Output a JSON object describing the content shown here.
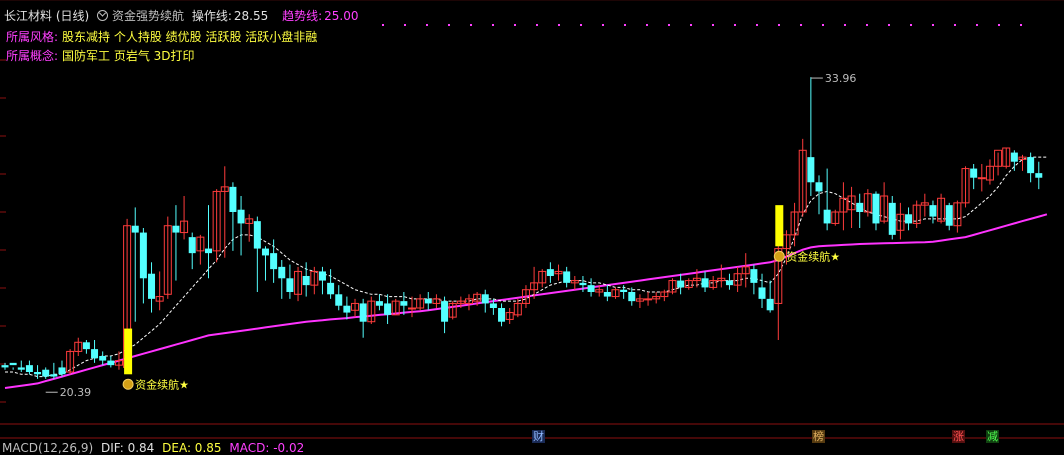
{
  "header": {
    "title": "长江材料 (日线)",
    "indicator": "资金强势续航",
    "op_label": "操作线:",
    "op_value": "28.55",
    "trend_label": "趋势线:",
    "trend_value": "25.00"
  },
  "info": {
    "style_label": "所属风格:",
    "style_value": "股东减持 个人持股 绩优股 活跃股 活跃小盘非融",
    "concept_label": "所属概念:",
    "concept_value": "国防军工 页岩气 3D打印"
  },
  "annotations": {
    "high_label": "33.96",
    "low_label": "20.39",
    "signal_label": "资金续航★"
  },
  "badges": {
    "cai": "财",
    "bang": "榜",
    "zhang": "涨",
    "jian": "减"
  },
  "footer": {
    "macd_label": "MACD(12,26,9)",
    "dif_label": "DIF: 0.84",
    "dea_label": "DEA: 0.85",
    "macd_value_label": "MACD: -0.02"
  },
  "colors": {
    "up": "#ff3c3c",
    "down": "#54ffff",
    "trend_line": "#ff33ff",
    "op_line": "#ffffff",
    "signal_bar": "#ffff00",
    "grid": "#8b1010"
  },
  "chart_data": {
    "type": "candlestick",
    "price_range": [
      19.0,
      36.5
    ],
    "candles": [
      [
        21.4,
        21.5,
        21.3,
        21.2
      ],
      [
        21.5,
        21.3,
        21.4,
        21.2
      ],
      [
        21.3,
        21.6,
        21.2,
        21.1
      ],
      [
        21.4,
        21.6,
        21.1,
        21.0
      ],
      [
        21.1,
        21.4,
        21.0,
        20.8
      ],
      [
        21.2,
        21.3,
        20.9,
        20.8
      ],
      [
        21.0,
        21.5,
        20.9,
        20.8
      ],
      [
        21.3,
        21.6,
        21.0,
        20.9
      ],
      [
        21.1,
        22.1,
        22.0,
        21.0
      ],
      [
        22.0,
        22.6,
        22.4,
        21.8
      ],
      [
        22.4,
        22.5,
        22.1,
        21.9
      ],
      [
        22.1,
        22.5,
        21.7,
        21.5
      ],
      [
        21.8,
        22.0,
        21.6,
        21.4
      ],
      [
        21.6,
        21.8,
        21.4,
        21.3
      ],
      [
        21.4,
        22.0,
        21.6,
        21.2
      ],
      [
        21.3,
        27.8,
        27.5,
        21.2
      ],
      [
        27.5,
        28.3,
        27.2,
        23.3
      ],
      [
        27.2,
        27.4,
        25.2,
        24.1
      ],
      [
        25.4,
        25.9,
        24.3,
        23.7
      ],
      [
        24.2,
        25.5,
        24.4,
        23.8
      ],
      [
        24.5,
        27.9,
        27.5,
        24.3
      ],
      [
        27.5,
        28.4,
        27.2,
        25.1
      ],
      [
        27.2,
        28.8,
        27.7,
        26.9
      ],
      [
        27.0,
        27.2,
        26.3,
        25.6
      ],
      [
        26.4,
        27.1,
        27.0,
        25.8
      ],
      [
        26.5,
        28.4,
        26.3,
        25.2
      ],
      [
        26.4,
        29.1,
        29.0,
        25.9
      ],
      [
        29.0,
        30.1,
        29.2,
        26.1
      ],
      [
        29.2,
        29.4,
        28.1,
        26.4
      ],
      [
        28.2,
        28.8,
        27.6,
        26.2
      ],
      [
        27.6,
        28.0,
        27.8,
        26.8
      ],
      [
        27.7,
        27.9,
        26.5,
        24.6
      ],
      [
        26.5,
        26.6,
        26.2,
        25.1
      ],
      [
        26.3,
        26.9,
        25.6,
        25.0
      ],
      [
        25.7,
        26.0,
        25.2,
        24.3
      ],
      [
        25.2,
        25.8,
        24.6,
        24.3
      ],
      [
        24.5,
        25.7,
        25.5,
        24.2
      ],
      [
        25.3,
        25.9,
        24.9,
        24.4
      ],
      [
        24.9,
        25.7,
        25.5,
        24.5
      ],
      [
        25.5,
        25.7,
        25.1,
        24.5
      ],
      [
        25.0,
        25.6,
        24.5,
        24.3
      ],
      [
        24.5,
        24.9,
        24.0,
        23.8
      ],
      [
        24.0,
        24.4,
        23.7,
        23.4
      ],
      [
        23.8,
        24.3,
        24.1,
        23.5
      ],
      [
        24.1,
        24.3,
        23.3,
        22.6
      ],
      [
        23.3,
        24.4,
        24.2,
        23.2
      ],
      [
        24.2,
        24.5,
        24.0,
        23.8
      ],
      [
        24.1,
        24.5,
        23.6,
        23.2
      ],
      [
        23.6,
        24.3,
        24.2,
        23.6
      ],
      [
        24.2,
        24.6,
        24.0,
        23.6
      ],
      [
        23.9,
        24.4,
        23.9,
        23.5
      ],
      [
        23.9,
        24.5,
        24.3,
        23.8
      ],
      [
        24.3,
        24.6,
        24.1,
        23.8
      ],
      [
        24.1,
        24.5,
        24.3,
        23.9
      ],
      [
        24.2,
        24.4,
        23.3,
        22.8
      ],
      [
        23.5,
        24.2,
        24.1,
        23.4
      ],
      [
        24.1,
        24.4,
        24.2,
        23.9
      ],
      [
        24.1,
        24.5,
        24.3,
        23.8
      ],
      [
        24.2,
        24.6,
        24.5,
        24.0
      ],
      [
        24.5,
        24.7,
        24.1,
        23.7
      ],
      [
        24.1,
        24.3,
        23.9,
        23.6
      ],
      [
        23.9,
        24.1,
        23.3,
        23.1
      ],
      [
        23.4,
        23.9,
        23.7,
        23.2
      ],
      [
        23.6,
        24.3,
        24.1,
        23.5
      ],
      [
        24.1,
        24.9,
        24.7,
        23.9
      ],
      [
        24.7,
        25.7,
        25.0,
        24.3
      ],
      [
        25.0,
        25.6,
        25.5,
        24.8
      ],
      [
        25.6,
        25.9,
        25.3,
        25.0
      ],
      [
        25.4,
        25.8,
        25.5,
        25.1
      ],
      [
        25.5,
        25.7,
        25.0,
        24.8
      ],
      [
        25.0,
        25.3,
        25.1,
        24.7
      ],
      [
        25.0,
        25.3,
        24.9,
        24.6
      ],
      [
        24.9,
        25.2,
        24.6,
        24.4
      ],
      [
        24.6,
        24.9,
        24.7,
        24.4
      ],
      [
        24.6,
        24.9,
        24.4,
        24.2
      ],
      [
        24.4,
        24.8,
        24.7,
        24.3
      ],
      [
        24.7,
        24.9,
        24.6,
        24.3
      ],
      [
        24.6,
        24.8,
        24.2,
        24.0
      ],
      [
        24.2,
        24.5,
        24.3,
        23.9
      ],
      [
        24.3,
        24.6,
        24.3,
        24.0
      ],
      [
        24.3,
        24.6,
        24.4,
        24.1
      ],
      [
        24.4,
        24.7,
        24.6,
        24.2
      ],
      [
        24.6,
        25.2,
        25.1,
        24.5
      ],
      [
        25.1,
        25.4,
        24.8,
        24.5
      ],
      [
        24.8,
        25.2,
        25.1,
        24.7
      ],
      [
        25.1,
        25.6,
        25.2,
        24.8
      ],
      [
        25.2,
        25.5,
        24.8,
        24.6
      ],
      [
        24.8,
        25.3,
        25.1,
        24.7
      ],
      [
        25.1,
        25.8,
        25.2,
        24.8
      ],
      [
        25.1,
        25.4,
        24.9,
        24.7
      ],
      [
        24.9,
        25.7,
        25.4,
        24.6
      ],
      [
        25.4,
        26.3,
        25.7,
        24.8
      ],
      [
        25.6,
        25.8,
        25.0,
        24.5
      ],
      [
        24.8,
        25.4,
        24.3,
        23.9
      ],
      [
        24.3,
        25.1,
        23.8,
        23.7
      ],
      [
        24.1,
        27.1,
        26.5,
        22.5
      ],
      [
        26.5,
        27.3,
        27.1,
        25.8
      ],
      [
        27.1,
        28.5,
        28.1,
        26.6
      ],
      [
        28.1,
        31.3,
        30.8,
        27.9
      ],
      [
        30.5,
        34.0,
        29.4,
        28.8
      ],
      [
        29.4,
        29.7,
        29.0,
        28.0
      ],
      [
        28.2,
        30.0,
        27.6,
        27.3
      ],
      [
        27.6,
        28.2,
        28.1,
        27.5
      ],
      [
        28.1,
        29.4,
        28.7,
        27.3
      ],
      [
        28.2,
        29.2,
        28.8,
        27.4
      ],
      [
        28.5,
        28.9,
        28.1,
        27.4
      ],
      [
        28.1,
        29.1,
        28.9,
        27.9
      ],
      [
        28.9,
        29.0,
        27.6,
        27.3
      ],
      [
        27.7,
        29.4,
        28.8,
        27.6
      ],
      [
        28.5,
        28.8,
        27.1,
        26.9
      ],
      [
        27.3,
        28.5,
        28.0,
        26.9
      ],
      [
        28.0,
        28.3,
        27.6,
        27.3
      ],
      [
        27.6,
        28.6,
        28.4,
        27.4
      ],
      [
        28.4,
        28.9,
        28.5,
        27.9
      ],
      [
        28.4,
        28.6,
        27.9,
        27.6
      ],
      [
        27.7,
        28.9,
        28.7,
        27.6
      ],
      [
        28.4,
        28.5,
        27.5,
        27.3
      ],
      [
        27.5,
        28.6,
        28.5,
        27.2
      ],
      [
        28.5,
        30.1,
        30.0,
        28.3
      ],
      [
        30.0,
        30.2,
        29.6,
        29.1
      ],
      [
        29.6,
        30.2,
        29.6,
        29.0
      ],
      [
        29.5,
        30.4,
        30.1,
        29.3
      ],
      [
        30.1,
        30.7,
        30.8,
        29.7
      ],
      [
        30.1,
        30.9,
        30.9,
        30.0
      ],
      [
        30.7,
        30.8,
        30.3,
        29.9
      ],
      [
        30.4,
        30.6,
        30.5,
        29.9
      ],
      [
        30.5,
        30.7,
        29.8,
        29.4
      ],
      [
        29.8,
        30.3,
        29.6,
        29.1
      ]
    ],
    "operation_line": [
      21.1,
      21.1,
      21.0,
      21.0,
      20.9,
      20.9,
      21.0,
      21.0,
      21.2,
      21.4,
      21.6,
      21.7,
      21.8,
      21.8,
      21.9,
      22.1,
      22.3,
      22.6,
      22.9,
      23.2,
      23.6,
      24.0,
      24.4,
      24.8,
      25.2,
      25.6,
      26.0,
      26.5,
      26.9,
      27.1,
      27.1,
      27.0,
      26.8,
      26.6,
      26.3,
      26.0,
      25.8,
      25.6,
      25.5,
      25.4,
      25.3,
      25.1,
      24.9,
      24.7,
      24.6,
      24.5,
      24.5,
      24.4,
      24.4,
      24.4,
      24.3,
      24.3,
      24.3,
      24.3,
      24.2,
      24.2,
      24.2,
      24.2,
      24.3,
      24.3,
      24.3,
      24.2,
      24.2,
      24.2,
      24.3,
      24.5,
      24.7,
      24.9,
      25.0,
      25.1,
      25.1,
      25.1,
      25.0,
      25.0,
      24.9,
      24.8,
      24.8,
      24.7,
      24.7,
      24.6,
      24.6,
      24.6,
      24.7,
      24.8,
      24.9,
      24.9,
      25.0,
      25.0,
      25.1,
      25.1,
      25.1,
      25.2,
      25.2,
      25.1,
      25.0,
      25.4,
      26.1,
      27.0,
      28.0,
      28.6,
      28.9,
      29.0,
      28.9,
      28.7,
      28.5,
      28.3,
      28.1,
      28.0,
      27.9,
      27.8,
      27.7,
      27.7,
      27.7,
      27.8,
      27.8,
      27.8,
      27.8,
      27.8,
      27.9,
      28.2,
      28.5,
      28.8,
      29.2,
      29.7,
      30.1,
      30.4,
      30.5,
      30.5,
      30.5
    ],
    "trend_line": [
      20.4,
      20.45,
      20.5,
      20.55,
      20.6,
      20.7,
      20.8,
      20.9,
      21.0,
      21.1,
      21.2,
      21.3,
      21.4,
      21.5,
      21.6,
      21.7,
      21.8,
      21.9,
      22.0,
      22.1,
      22.2,
      22.3,
      22.4,
      22.5,
      22.6,
      22.7,
      22.75,
      22.8,
      22.85,
      22.9,
      22.95,
      23.0,
      23.05,
      23.1,
      23.15,
      23.2,
      23.25,
      23.3,
      23.33,
      23.36,
      23.4,
      23.43,
      23.46,
      23.5,
      23.53,
      23.56,
      23.6,
      23.63,
      23.66,
      23.7,
      23.73,
      23.76,
      23.8,
      23.85,
      23.9,
      23.95,
      24.0,
      24.05,
      24.1,
      24.15,
      24.2,
      24.25,
      24.3,
      24.35,
      24.4,
      24.45,
      24.5,
      24.55,
      24.6,
      24.65,
      24.7,
      24.75,
      24.8,
      24.85,
      24.9,
      24.95,
      25.0,
      25.05,
      25.1,
      25.15,
      25.2,
      25.25,
      25.3,
      25.35,
      25.4,
      25.45,
      25.5,
      25.55,
      25.6,
      25.65,
      25.7,
      25.75,
      25.8,
      25.85,
      25.9,
      26.0,
      26.15,
      26.3,
      26.45,
      26.55,
      26.6,
      26.62,
      26.64,
      26.66,
      26.68,
      26.7,
      26.71,
      26.72,
      26.73,
      26.74,
      26.75,
      26.76,
      26.77,
      26.78,
      26.8,
      26.85,
      26.9,
      26.95,
      27.0,
      27.1,
      27.2,
      27.3,
      27.4,
      27.5,
      27.6,
      27.7,
      27.8,
      27.9,
      28.0
    ],
    "signal_bars": [
      {
        "index": 15,
        "low": 21.0,
        "high": 23.0
      },
      {
        "index": 95,
        "low": 26.6,
        "high": 28.4
      }
    ],
    "signal_markers": [
      15,
      95
    ],
    "high_point": {
      "index": 99,
      "value": 33.96
    },
    "low_point": {
      "index": 5,
      "value": 20.39
    }
  }
}
